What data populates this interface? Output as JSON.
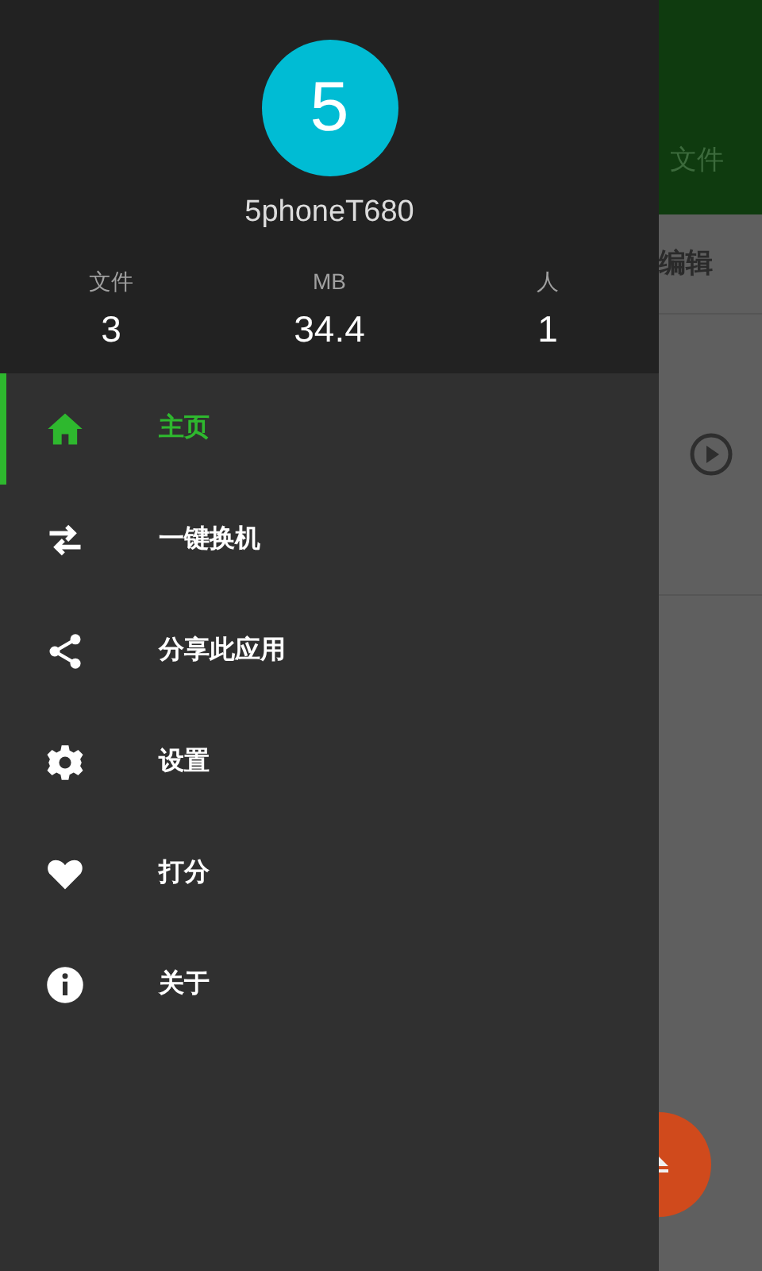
{
  "drawer": {
    "avatar": "5",
    "device_name": "5phoneT680",
    "stats": [
      {
        "label": "文件",
        "value": "3"
      },
      {
        "label": "MB",
        "value": "34.4"
      },
      {
        "label": "人",
        "value": "1"
      }
    ],
    "menu": [
      {
        "label": "主页",
        "selected": true
      },
      {
        "label": "一键换机",
        "selected": false
      },
      {
        "label": "分享此应用",
        "selected": false
      },
      {
        "label": "设置",
        "selected": false
      },
      {
        "label": "打分",
        "selected": false
      },
      {
        "label": "关于",
        "selected": false
      }
    ]
  },
  "background": {
    "tab": "文件",
    "action": "编辑"
  }
}
